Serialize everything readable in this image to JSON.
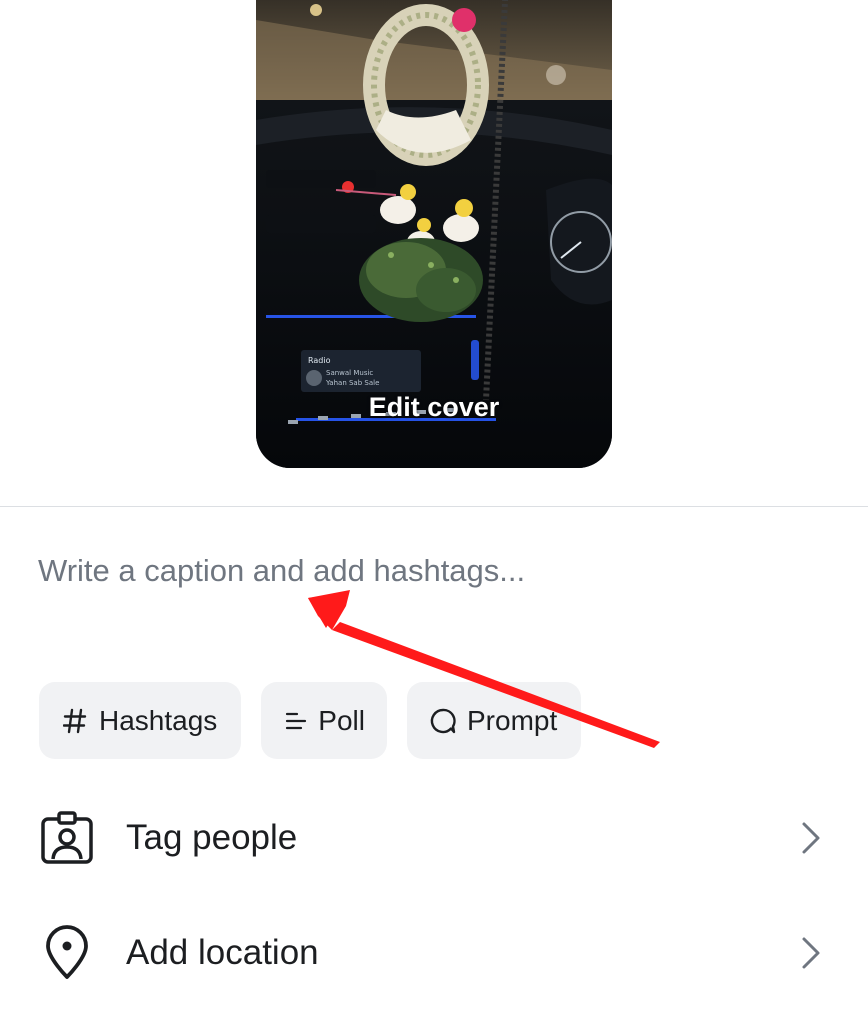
{
  "cover": {
    "edit_label": "Edit cover",
    "screen_lines": [
      "Radio",
      "Sanwal Music",
      "Yahan Sab Sale"
    ]
  },
  "caption": {
    "placeholder": "Write a caption and add hashtags...",
    "value": ""
  },
  "chips": [
    {
      "icon": "hash-icon",
      "label": "Hashtags"
    },
    {
      "icon": "poll-icon",
      "label": "Poll"
    },
    {
      "icon": "prompt-icon",
      "label": "Prompt"
    }
  ],
  "rows": [
    {
      "icon": "tag-people-icon",
      "label": "Tag people"
    },
    {
      "icon": "location-pin-icon",
      "label": "Add location"
    }
  ],
  "colors": {
    "text": "#1c1e21",
    "placeholder": "#6f7680",
    "chip_bg": "#f1f2f4",
    "annotation": "#ff1a1a"
  }
}
